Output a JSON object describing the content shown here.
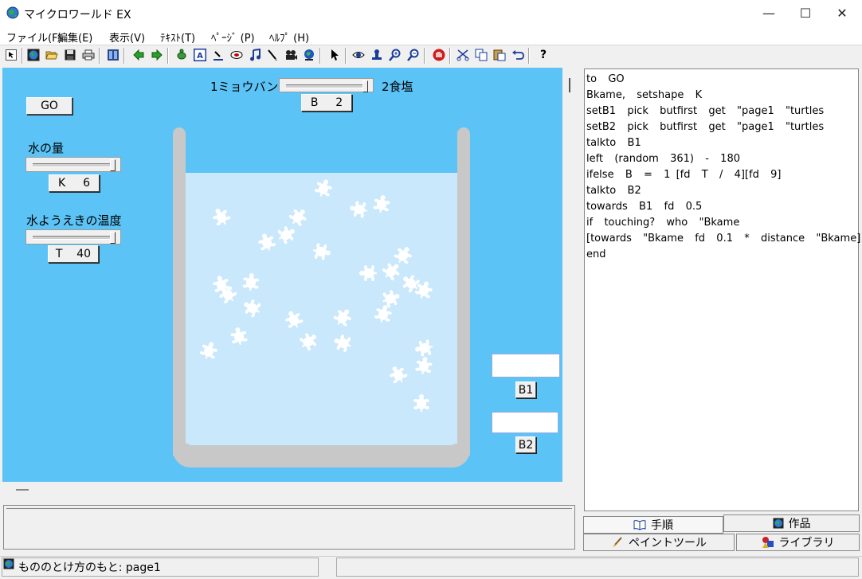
{
  "window": {
    "title": "マイクロワールド EX",
    "controls": {
      "minimize": "—",
      "maximize": "☐",
      "close": "✕"
    }
  },
  "menu": [
    "ファイル(F)",
    "編集(E)",
    "表示(V)",
    "ﾃｷｽﾄ(T)",
    "ﾍﾟｰｼﾞ (P)",
    "ﾍﾙﾌﾟ (H)"
  ],
  "toolbar": {
    "icons": [
      "pointer-icon",
      "globe-icon",
      "open-folder-icon",
      "save-icon",
      "print-icon",
      "page-icon",
      "back-arrow-icon",
      "forward-arrow-icon",
      "turtle-icon",
      "textbox-icon",
      "slider-icon",
      "button-icon",
      "music-icon",
      "paint-brush-icon",
      "camera-icon",
      "globe-stamp-icon",
      "arrow-cursor-icon",
      "eye-icon",
      "stamp-icon",
      "zoom-in-icon",
      "zoom-out-icon",
      "stop-hand-icon",
      "scissors-icon",
      "copy-icon",
      "paste-icon",
      "undo-icon",
      "help-icon"
    ],
    "help_label": "?"
  },
  "canvas": {
    "go_button": "GO",
    "slider_type": {
      "left_label": "1ミョウバン",
      "right_label": "2食塩",
      "var": "B",
      "value": "2",
      "level": 1.0
    },
    "slider_water": {
      "label": "水の量",
      "var": "K",
      "value": "6",
      "level": 1.0
    },
    "slider_temp": {
      "label": "水ようえきの温度",
      "var": "T",
      "value": "40",
      "level": 1.0
    },
    "b1_label": "B1",
    "b2_label": "B2",
    "colors": {
      "background": "#5bc3f5",
      "water": "#c9e8fb",
      "beaker": "#c8c8c8",
      "turtle": "#ffffff"
    }
  },
  "code": [
    "to  GO",
    "Bkame,  setshape  K",
    "setB1  pick  butfirst  get  \"page1  \"turtles",
    "setB2  pick  butfirst  get  \"page1  \"turtles",
    "talkto  B1",
    "left  (random  361)  -  180",
    "ifelse  B  =  1 [fd  T  /  4][fd  9]",
    "talkto  B2",
    "towards  B1  fd  0.5",
    "if  touching?  who  \"Bkame",
    "[towards  \"Bkame  fd  0.1  *  distance  \"Bkame]",
    "end"
  ],
  "tabs": {
    "procedures": "手順",
    "project": "作品",
    "paint": "ペイントツール",
    "library": "ライブラリ"
  },
  "status": {
    "text": "もののとけ方のもと: page1"
  }
}
